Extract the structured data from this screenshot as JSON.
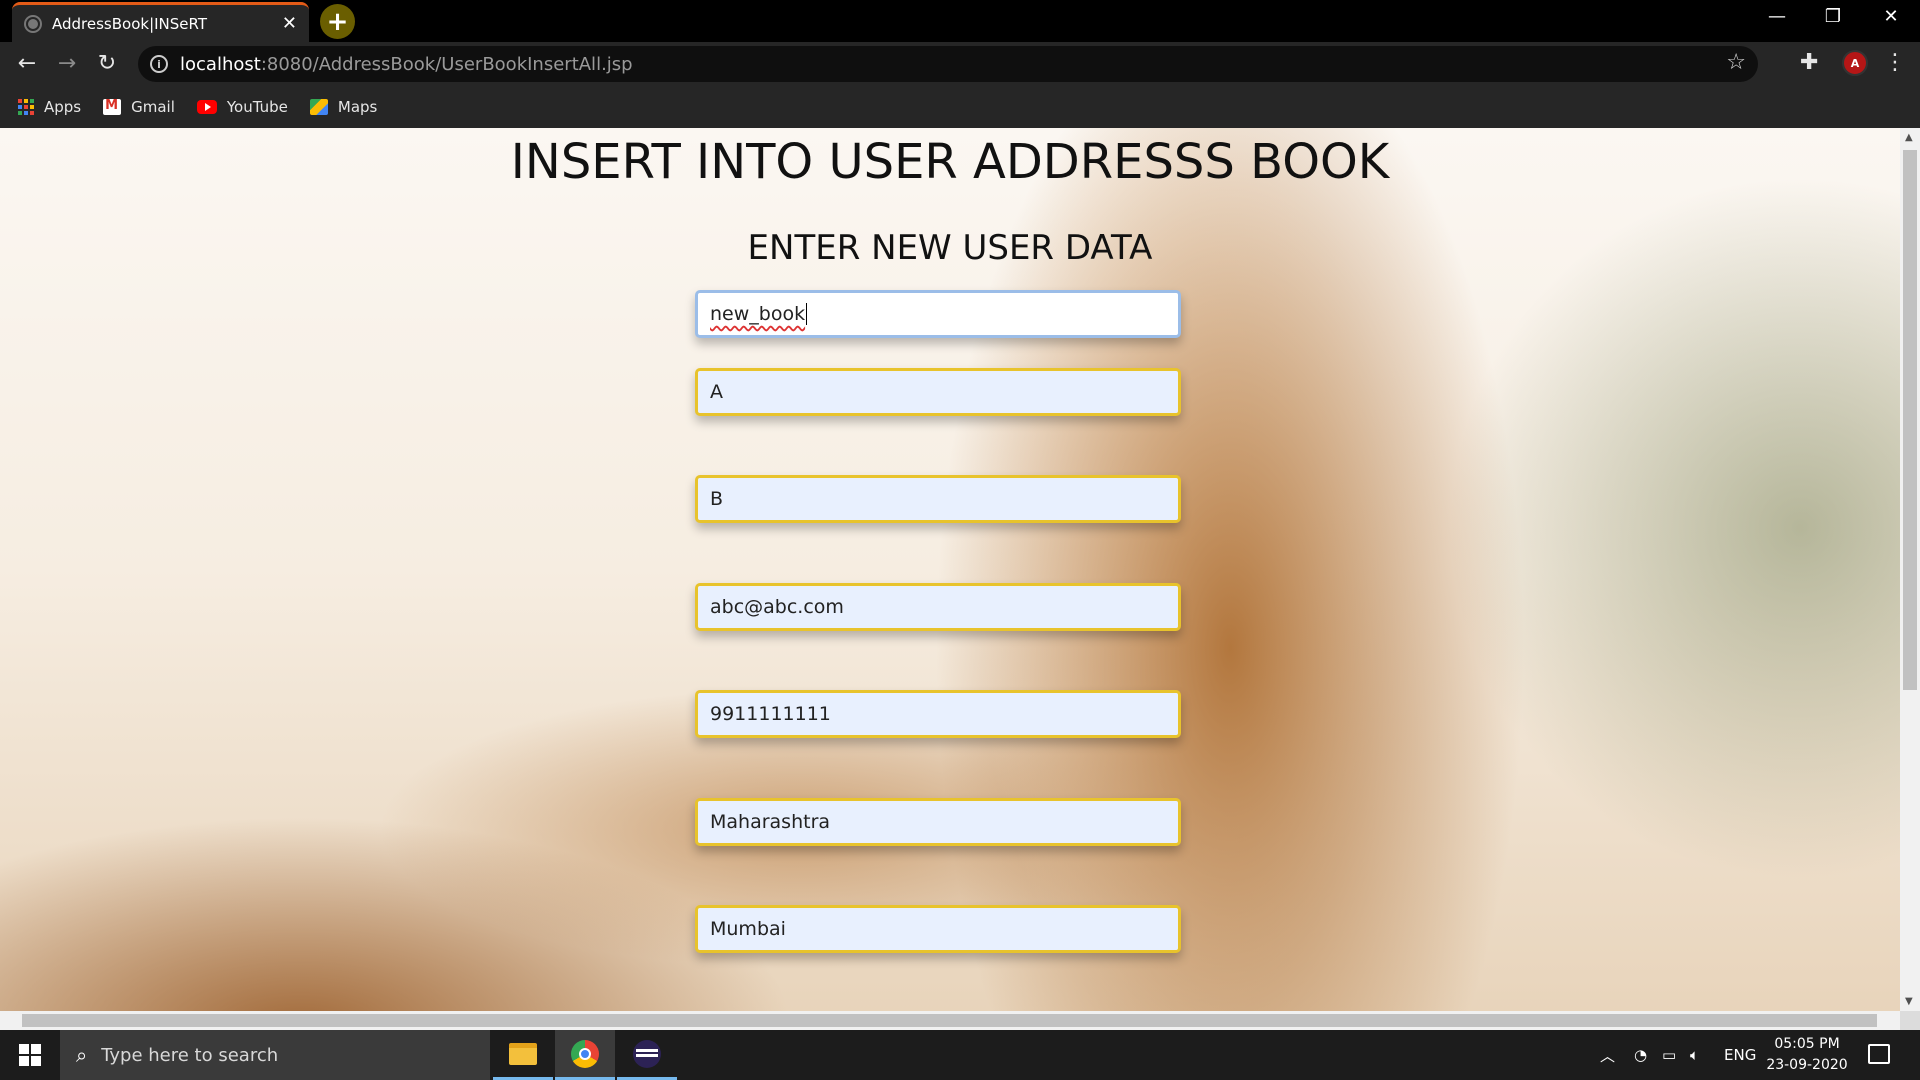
{
  "browser": {
    "tab_title": "AddressBook|INSeRT",
    "tab_close": "✕",
    "new_tab": "+",
    "url_host": "localhost",
    "url_path": ":8080/AddressBook/UserBookInsertAll.jsp",
    "profile_initial": "A",
    "window_controls": {
      "minimize": "—",
      "restore": "❐",
      "close": "✕"
    }
  },
  "bookmarks": [
    {
      "label": "Apps",
      "icon": "apps-grid-icon"
    },
    {
      "label": "Gmail",
      "icon": "gmail-icon"
    },
    {
      "label": "YouTube",
      "icon": "youtube-icon"
    },
    {
      "label": "Maps",
      "icon": "maps-icon"
    }
  ],
  "page": {
    "heading": "INSERT INTO USER ADDRESSS BOOK",
    "subheading": "ENTER NEW USER DATA",
    "fields": [
      {
        "value": "new_book",
        "focused": true
      },
      {
        "value": "A"
      },
      {
        "value": "B"
      },
      {
        "value": "abc@abc.com"
      },
      {
        "value": "9911111111"
      },
      {
        "value": "Maharashtra"
      },
      {
        "value": "Mumbai"
      }
    ]
  },
  "taskbar": {
    "search_placeholder": "Type here to search",
    "language": "ENG",
    "time": "05:05 PM",
    "date": "23-09-2020"
  },
  "colors": {
    "field_border": "#e8c32c",
    "field_bg": "#e8f0fe",
    "tab_accent": "#e35b17"
  }
}
